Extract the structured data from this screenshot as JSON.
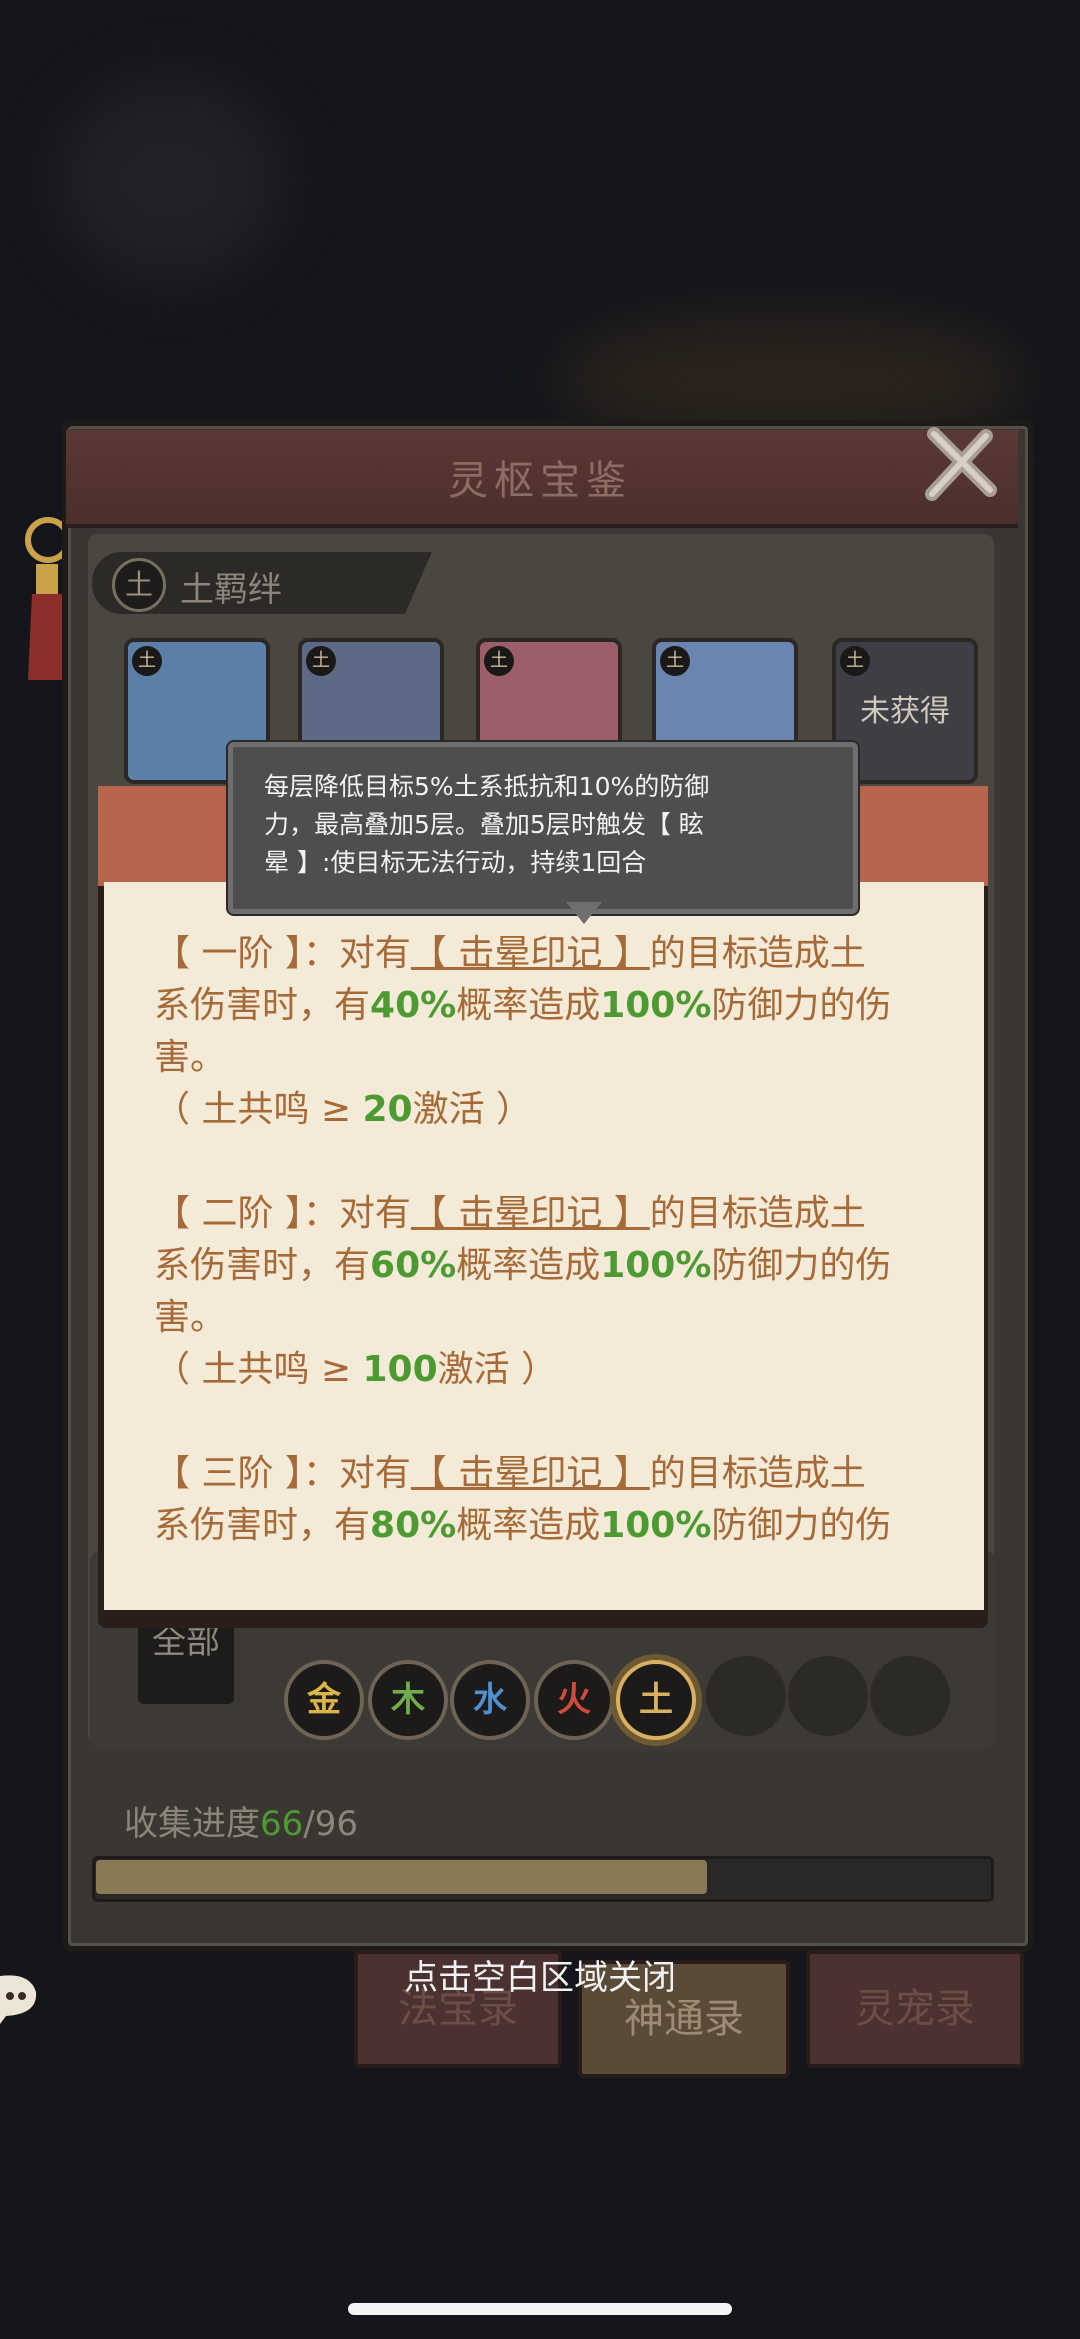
{
  "panel": {
    "title": "灵枢宝鉴"
  },
  "section": {
    "icon_char": "土",
    "label": "土羁绊"
  },
  "cards": [
    {
      "badge": "土",
      "color": "#5c7fa8",
      "obtained": true,
      "label": ""
    },
    {
      "badge": "土",
      "color": "#5d6a86",
      "obtained": true,
      "label": ""
    },
    {
      "badge": "土",
      "color": "#9c5f6a",
      "obtained": true,
      "label": ""
    },
    {
      "badge": "土",
      "color": "#6a86b0",
      "obtained": true,
      "label": ""
    },
    {
      "badge": "土",
      "color": "#3e3e44",
      "obtained": false,
      "label": "未获得"
    }
  ],
  "tooltip": {
    "line1": "每层降低目标5%土系抵抗和10%的防御",
    "line2": "力，最高叠加5层。叠加5层时触发【 眩",
    "line3": "晕 】:使目标无法行动，持续1回合"
  },
  "tiers": [
    {
      "tier": "【 一阶 】：",
      "pre": "对有",
      "mark": "【 击晕印记 】",
      "post": "的目标造成土",
      "line2a": "系伤害时，有",
      "prob": "40%",
      "line2b": "概率造成",
      "dmg": "100%",
      "line2c": "防御力的伤",
      "line3": "害。",
      "act_pre": "（ 土共鸣 ≥ ",
      "act_val": "20",
      "act_post": "激活 ）"
    },
    {
      "tier": "【 二阶 】：",
      "pre": "对有",
      "mark": "【 击晕印记 】",
      "post": "的目标造成土",
      "line2a": "系伤害时，有",
      "prob": "60%",
      "line2b": "概率造成",
      "dmg": "100%",
      "line2c": "防御力的伤",
      "line3": "害。",
      "act_pre": "（ 土共鸣 ≥ ",
      "act_val": "100",
      "act_post": "激活 ）"
    },
    {
      "tier": "【 三阶 】：",
      "pre": "对有",
      "mark": "【 击晕印记 】",
      "post": "的目标造成土",
      "line2a": "系伤害时，有",
      "prob": "80%",
      "line2b": "概率造成",
      "dmg": "100%",
      "line2c": "防御力的伤"
    }
  ],
  "filter": {
    "all_label": "全部",
    "elements": [
      {
        "char": "金",
        "color": "#d9b54a",
        "selected": false
      },
      {
        "char": "木",
        "color": "#6fae4c",
        "selected": false
      },
      {
        "char": "水",
        "color": "#4f8fd0",
        "selected": false
      },
      {
        "char": "火",
        "color": "#d04a3e",
        "selected": false
      },
      {
        "char": "土",
        "color": "#d9b062",
        "selected": true
      }
    ]
  },
  "collection": {
    "label": "收集进度",
    "current": "66",
    "total": "/96",
    "progress": 0.6875
  },
  "tabs": [
    {
      "label": "法宝录",
      "active": false
    },
    {
      "label": "神通录",
      "active": true
    },
    {
      "label": "灵宠录",
      "active": false
    }
  ],
  "close_hint": "点击空白区域关闭"
}
